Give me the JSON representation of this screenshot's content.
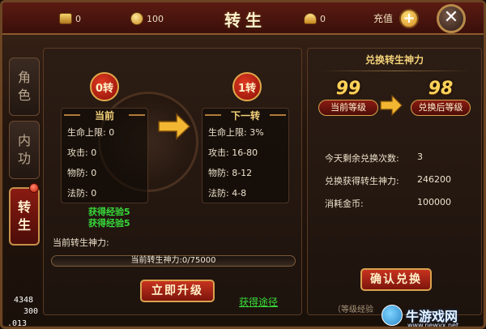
{
  "header": {
    "title": "转生",
    "resources": [
      {
        "icon": "gold-bar-icon",
        "value": "0"
      },
      {
        "icon": "coin-icon",
        "value": "100"
      },
      {
        "icon": "ingot-icon",
        "value": "0"
      }
    ],
    "recharge_label": "充值",
    "plus_symbol": "+",
    "close_symbol": "✕"
  },
  "tabs": [
    {
      "label_top": "角",
      "label_bottom": "色",
      "active": false
    },
    {
      "label_top": "内",
      "label_bottom": "功",
      "active": false
    },
    {
      "label_top": "转",
      "label_bottom": "生",
      "active": true
    }
  ],
  "current": {
    "badge": "0转",
    "title": "当前",
    "stats": [
      {
        "label": "生命上限:",
        "value": "0"
      },
      {
        "label": "攻击:",
        "value": "0"
      },
      {
        "label": "物防:",
        "value": "0"
      },
      {
        "label": "法防:",
        "value": "0"
      }
    ]
  },
  "next": {
    "badge": "1转",
    "title": "下一转",
    "stats": [
      {
        "label": "生命上限:",
        "value": "3%"
      },
      {
        "label": "攻击:",
        "value": "16-80"
      },
      {
        "label": "物防:",
        "value": "8-12"
      },
      {
        "label": "法防:",
        "value": "4-8"
      }
    ]
  },
  "exp_gain": [
    "获得经验5",
    "获得经验5"
  ],
  "power": {
    "label": "当前转生神力:",
    "bar_text": "当前转生神力:0/75000",
    "current": 0,
    "max": 75000
  },
  "upgrade_button": "立即升级",
  "obtain_link": "获得途径",
  "exchange": {
    "header": "兑换转生神力",
    "current_level": "99",
    "current_level_label": "当前等级",
    "after_level": "98",
    "after_level_label": "兑换后等级",
    "rows": [
      {
        "label": "今天剩余兑换次数:",
        "value": "3"
      },
      {
        "label": "兑换获得转生神力:",
        "value": "246200"
      },
      {
        "label": "消耗金币:",
        "value": "100000"
      }
    ],
    "confirm_button": "确认兑换",
    "footnote": "（等级经验"
  },
  "watermark": {
    "name": "牛游戏网",
    "url": "www.newyx.net"
  },
  "debug": [
    "4348",
    "300",
    ".013"
  ],
  "colors": {
    "accent_gold": "#f3d27a",
    "button_red": "#c7331f",
    "link_green": "#3adf3a"
  }
}
